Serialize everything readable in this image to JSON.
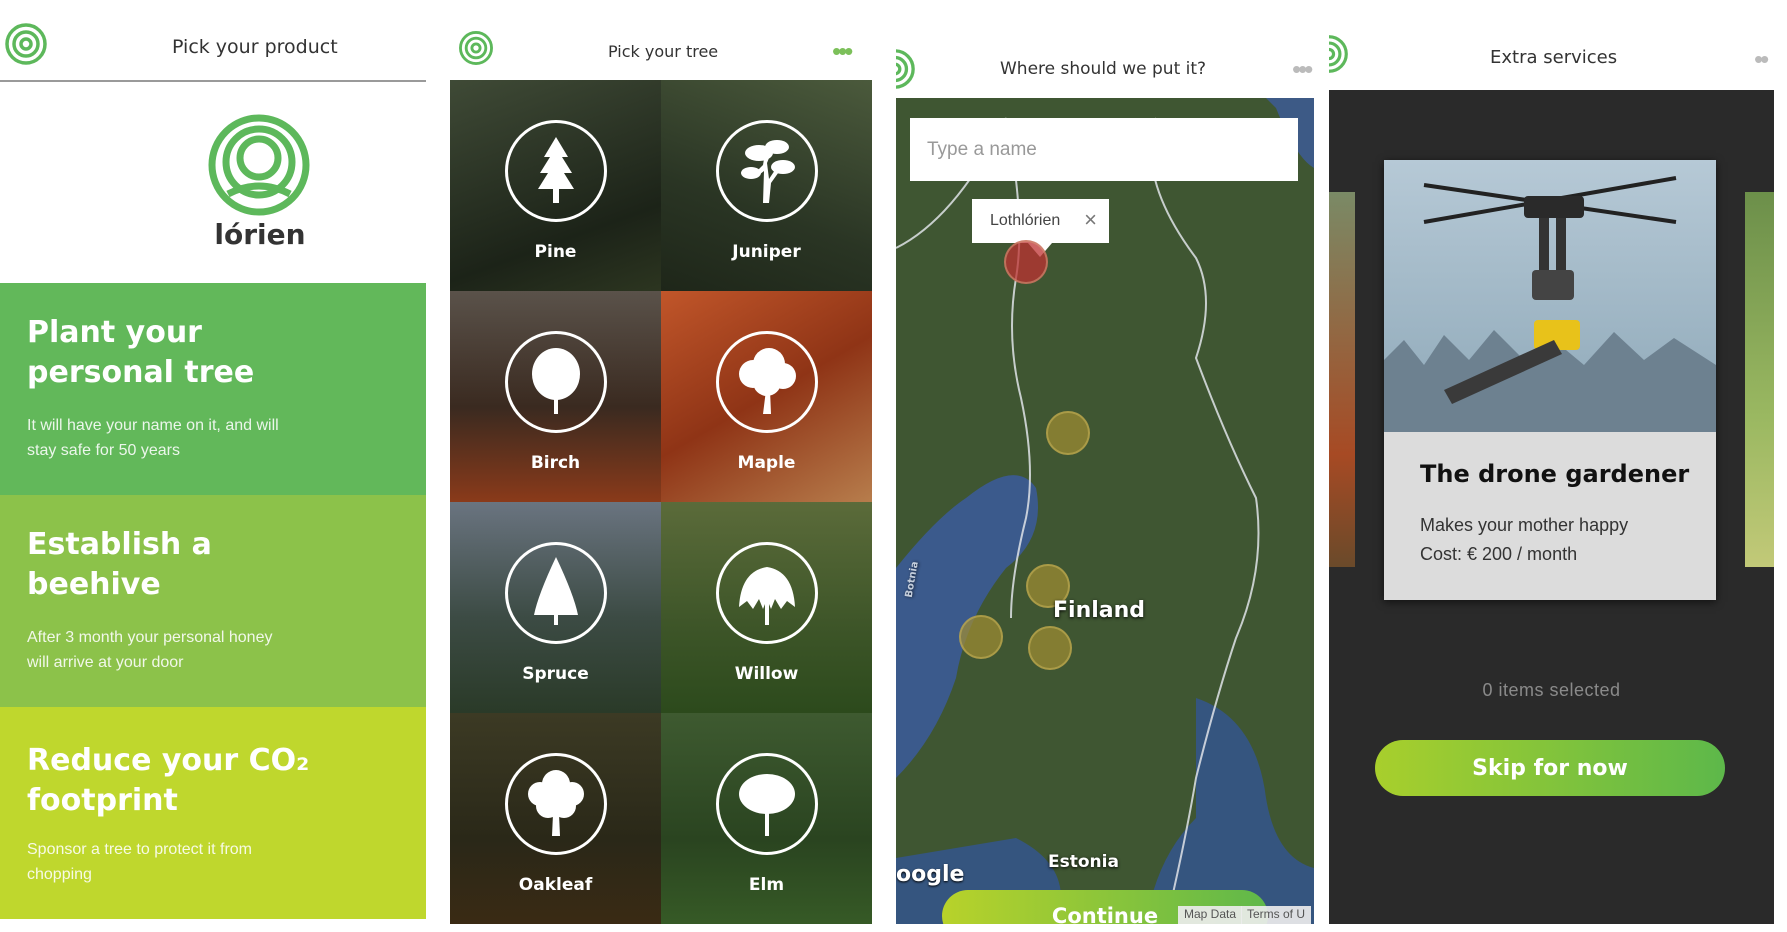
{
  "brand": {
    "name": "lórien",
    "green": "#5db85b"
  },
  "screen1": {
    "title": "Pick your product",
    "cards": [
      {
        "title_line1": "Plant your",
        "title_line2": "personal tree",
        "desc_line1": "It will have your name on it, and will",
        "desc_line2": "stay safe for 50 years",
        "color": "#62b85a"
      },
      {
        "title_line1": "Establish a",
        "title_line2": "beehive",
        "desc_line1": "After 3 month your personal honey",
        "desc_line2": "will arrive at your door",
        "color": "#8cc24a"
      },
      {
        "title_line1": "Reduce your CO₂",
        "title_line2": "footprint",
        "desc_line1": "Sponsor a tree to protect it from",
        "desc_line2": "chopping",
        "color": "#bfd72d"
      }
    ]
  },
  "screen2": {
    "title": "Pick your tree",
    "trees": [
      {
        "name": "Pine",
        "icon": "pine-icon"
      },
      {
        "name": "Juniper",
        "icon": "juniper-bonsai-icon"
      },
      {
        "name": "Birch",
        "icon": "birch-icon"
      },
      {
        "name": "Maple",
        "icon": "maple-icon"
      },
      {
        "name": "Spruce",
        "icon": "spruce-icon"
      },
      {
        "name": "Willow",
        "icon": "willow-icon"
      },
      {
        "name": "Oakleaf",
        "icon": "oak-icon"
      },
      {
        "name": "Elm",
        "icon": "elm-icon"
      }
    ]
  },
  "screen3": {
    "title": "Where should we put it?",
    "input_placeholder": "Type a name",
    "tooltip_label": "Lothlórien",
    "map_labels": {
      "country": "Finland",
      "neighbor": "Estonia",
      "google": "oogle",
      "sea": "Botnia"
    },
    "attribution": {
      "data": "Map Data",
      "terms": "Terms of U"
    },
    "continue_label": "Continue"
  },
  "screen4": {
    "title": "Extra services",
    "service": {
      "title": "The drone gardener",
      "desc": "Makes your mother happy",
      "cost": "Cost: € 200 / month"
    },
    "selected_text": "0 items selected",
    "skip_label": "Skip for now"
  }
}
